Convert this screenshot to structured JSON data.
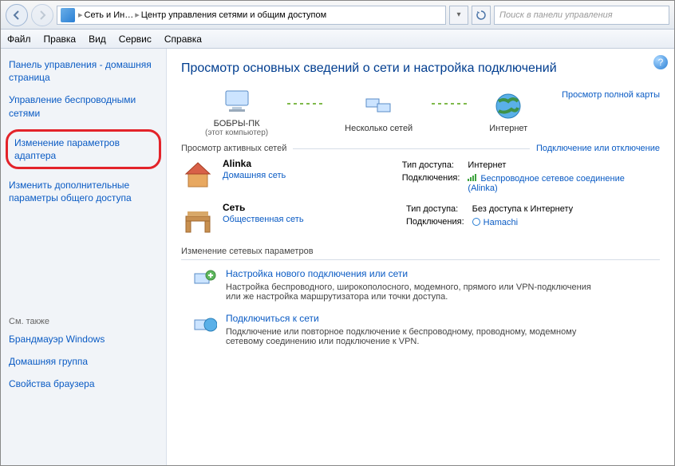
{
  "toolbar": {
    "breadcrumb1": "Сеть и Ин…",
    "breadcrumb2": "Центр управления сетями и общим доступом",
    "search_placeholder": "Поиск в панели управления"
  },
  "menubar": [
    "Файл",
    "Правка",
    "Вид",
    "Сервис",
    "Справка"
  ],
  "sidebar": {
    "links": [
      "Панель управления - домашняя страница",
      "Управление беспроводными сетями",
      "Изменение параметров адаптера",
      "Изменить дополнительные параметры общего доступа"
    ],
    "see_also_hdr": "См. также",
    "see_also": [
      "Брандмауэр Windows",
      "Домашняя группа",
      "Свойства браузера"
    ]
  },
  "main": {
    "title": "Просмотр основных сведений о сети и настройка подключений",
    "map": {
      "node1": "БОБРЫ-ПК",
      "node1_sub": "(этот компьютер)",
      "node2": "Несколько сетей",
      "node3": "Интернет",
      "full_map_link": "Просмотр полной карты"
    },
    "active_hdr": "Просмотр активных сетей",
    "active_link": "Подключение или отключение",
    "net1": {
      "name": "Alinka",
      "sub": "Домашняя сеть",
      "type_lbl": "Тип доступа:",
      "type_val": "Интернет",
      "conn_lbl": "Подключения:",
      "conn_val": "Беспроводное сетевое соединение (Alinka)"
    },
    "net2": {
      "name": "Сеть",
      "sub": "Общественная сеть",
      "type_lbl": "Тип доступа:",
      "type_val": "Без доступа к Интернету",
      "conn_lbl": "Подключения:",
      "conn_val": "Hamachi"
    },
    "params_hdr": "Изменение сетевых параметров",
    "p1": {
      "link": "Настройка нового подключения или сети",
      "desc": "Настройка беспроводного, широкополосного, модемного, прямого или VPN-подключения или же настройка маршрутизатора или точки доступа."
    },
    "p2": {
      "link": "Подключиться к сети",
      "desc": "Подключение или повторное подключение к беспроводному, проводному, модемному сетевому соединению или подключение к VPN."
    }
  }
}
